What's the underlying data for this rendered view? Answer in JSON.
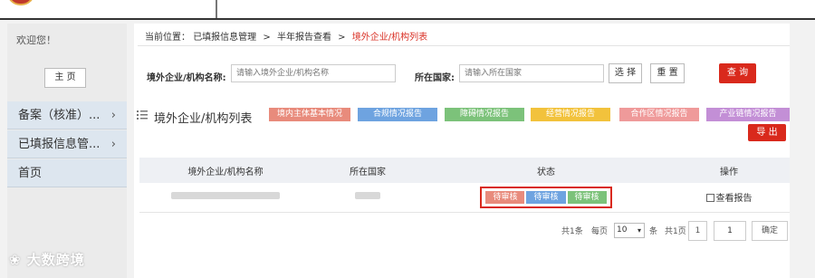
{
  "sidebar": {
    "welcome": "欢迎您！",
    "home_button": "主 页",
    "items": [
      {
        "label": "备案（核准）..."
      },
      {
        "label": "已填报信息管..."
      },
      {
        "label": "首页"
      }
    ]
  },
  "breadcrumb": {
    "prefix": "当前位置：",
    "level1": "已填报信息管理",
    "level2": "半年报告查看",
    "current": "境外企业/机构列表",
    "separator": ">"
  },
  "filters": {
    "company_label": "境外企业/机构名称:",
    "company_placeholder": "请输入境外企业/机构名称",
    "country_label": "所在国家:",
    "country_placeholder": "请输入所在国家",
    "select_button": "选 择",
    "reset_button": "重 置",
    "query_button": "查 询"
  },
  "list": {
    "title": "境外企业/机构列表",
    "tags": [
      {
        "label": "境内主体基本情况",
        "color": "#e88b7c"
      },
      {
        "label": "合规情况报告",
        "color": "#6ea3e0"
      },
      {
        "label": "障碍情况报告",
        "color": "#7cc27a"
      },
      {
        "label": "经营情况报告",
        "color": "#f2c23c"
      },
      {
        "label": "合作区情况报告",
        "color": "#ef9a9a"
      },
      {
        "label": "产业链情况报告",
        "color": "#c38fd6"
      }
    ],
    "export_button": "导 出"
  },
  "table": {
    "headers": [
      "境外企业/机构名称",
      "所在国家",
      "状态",
      "操作"
    ],
    "rows": [
      {
        "statuses": [
          {
            "label": "待审核",
            "color": "#e88b7c"
          },
          {
            "label": "待审核",
            "color": "#6ea3e0"
          },
          {
            "label": "待审核",
            "color": "#7cc27a"
          }
        ],
        "action": "查看报告"
      }
    ]
  },
  "pagination": {
    "total": "共1条",
    "per_page_label": "每页",
    "per_page_value": "10",
    "per_page_unit": "条",
    "pages": "共1页",
    "current_page": "1",
    "page_input": "1",
    "confirm": "确定"
  },
  "watermark": "大数跨境"
}
